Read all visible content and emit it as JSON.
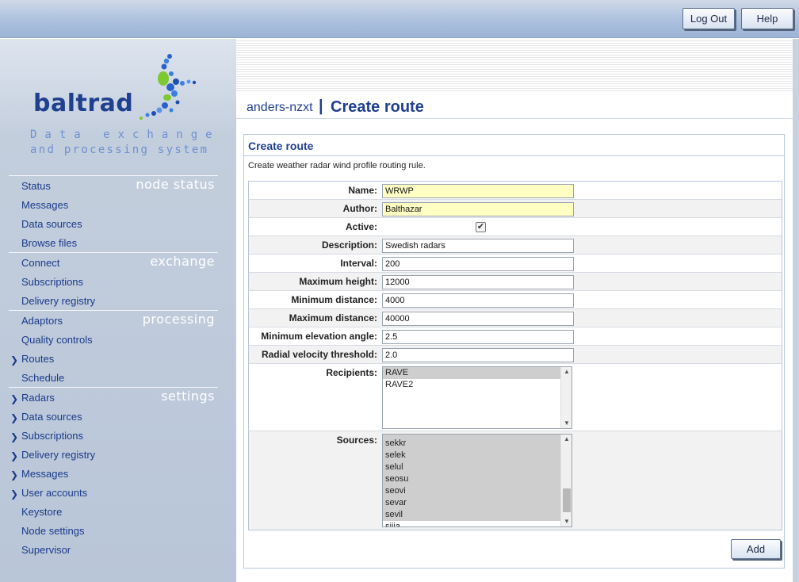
{
  "header": {
    "logout_label": "Log Out",
    "help_label": "Help"
  },
  "logo": {
    "wordmark": "baltrad",
    "tagline1": "Data exchange",
    "tagline2": "and processing system"
  },
  "sidebar": {
    "sections": [
      {
        "label": "node status",
        "items": [
          {
            "label": "Status",
            "expandable": false
          },
          {
            "label": "Messages",
            "expandable": false
          },
          {
            "label": "Data sources",
            "expandable": false
          },
          {
            "label": "Browse files",
            "expandable": false
          }
        ]
      },
      {
        "label": "exchange",
        "items": [
          {
            "label": "Connect",
            "expandable": false
          },
          {
            "label": "Subscriptions",
            "expandable": false
          },
          {
            "label": "Delivery registry",
            "expandable": false
          }
        ]
      },
      {
        "label": "processing",
        "items": [
          {
            "label": "Adaptors",
            "expandable": false
          },
          {
            "label": "Quality controls",
            "expandable": false
          },
          {
            "label": "Routes",
            "expandable": true
          },
          {
            "label": "Schedule",
            "expandable": false
          }
        ]
      },
      {
        "label": "settings",
        "items": [
          {
            "label": "Radars",
            "expandable": true
          },
          {
            "label": "Data sources",
            "expandable": true
          },
          {
            "label": "Subscriptions",
            "expandable": true
          },
          {
            "label": "Delivery registry",
            "expandable": true
          },
          {
            "label": "Messages",
            "expandable": true
          },
          {
            "label": "User accounts",
            "expandable": true
          },
          {
            "label": "Keystore",
            "expandable": false
          },
          {
            "label": "Node settings",
            "expandable": false
          },
          {
            "label": "Supervisor",
            "expandable": false
          }
        ]
      }
    ]
  },
  "page": {
    "node_name": "anders-nzxt",
    "separator": "|",
    "title": "Create route"
  },
  "panel": {
    "title": "Create route",
    "description": "Create weather radar wind profile routing rule.",
    "fields": {
      "name": {
        "label": "Name:",
        "value": "WRWP"
      },
      "author": {
        "label": "Author:",
        "value": "Balthazar"
      },
      "active": {
        "label": "Active:",
        "checked": true,
        "check_glyph": "✔"
      },
      "description": {
        "label": "Description:",
        "value": "Swedish radars"
      },
      "interval": {
        "label": "Interval:",
        "value": "200"
      },
      "max_height": {
        "label": "Maximum height:",
        "value": "12000"
      },
      "min_distance": {
        "label": "Minimum distance:",
        "value": "4000"
      },
      "max_distance": {
        "label": "Maximum distance:",
        "value": "40000"
      },
      "min_elev": {
        "label": "Minimum elevation angle:",
        "value": "2.5"
      },
      "radial_vel": {
        "label": "Radial velocity threshold:",
        "value": "2.0"
      },
      "recipients": {
        "label": "Recipients:",
        "options": [
          "RAVE",
          "RAVE2"
        ],
        "selected": [
          "RAVE"
        ]
      },
      "sources": {
        "label": "Sources:",
        "options": [
          "sekkr",
          "selek",
          "selul",
          "seosu",
          "seovi",
          "sevar",
          "sevil",
          "sijia"
        ],
        "selected": [
          "sekkr",
          "selek",
          "selul",
          "seosu",
          "seovi",
          "sevar",
          "sevil"
        ]
      }
    },
    "add_label": "Add"
  },
  "colors": {
    "accent": "#1f3f8f",
    "required_field": "#ffffc4",
    "sidebar": "#b9c6d8"
  }
}
